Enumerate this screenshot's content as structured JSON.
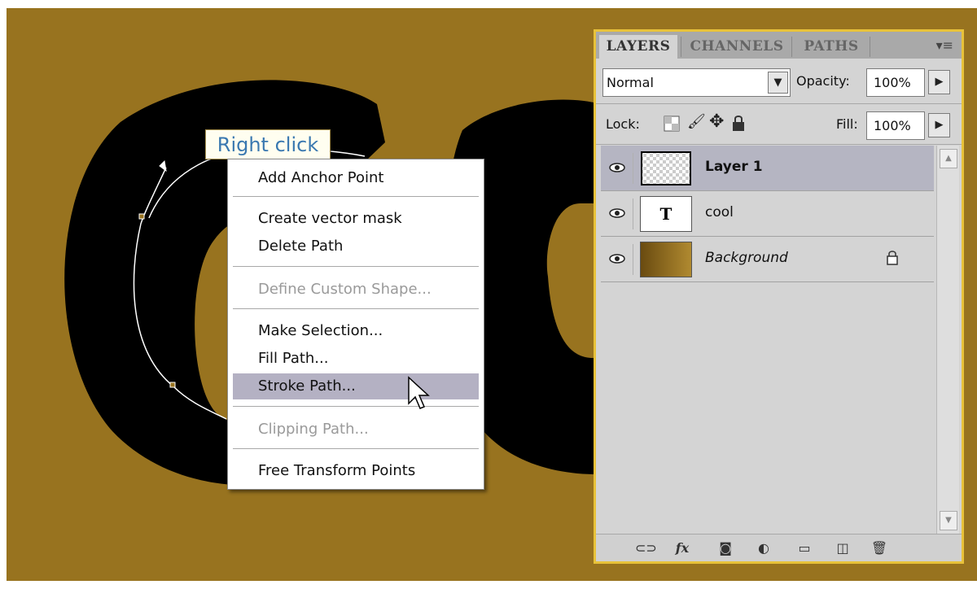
{
  "tooltip": "Right click",
  "context_menu": {
    "items": [
      {
        "label": "Add Anchor Point",
        "enabled": true
      },
      {
        "label": "Create vector mask",
        "enabled": true
      },
      {
        "label": "Delete Path",
        "enabled": true
      },
      {
        "label": "Define Custom Shape...",
        "enabled": false
      },
      {
        "label": "Make Selection...",
        "enabled": true
      },
      {
        "label": "Fill Path...",
        "enabled": true
      },
      {
        "label": "Stroke Path...",
        "enabled": true,
        "highlighted": true
      },
      {
        "label": "Clipping Path...",
        "enabled": false
      },
      {
        "label": "Free Transform Points",
        "enabled": true
      }
    ]
  },
  "layers_panel": {
    "tabs": [
      "LAYERS",
      "CHANNELS",
      "PATHS"
    ],
    "active_tab": "LAYERS",
    "blend_mode": "Normal",
    "opacity_label": "Opacity:",
    "opacity": "100%",
    "lock_label": "Lock:",
    "fill_label": "Fill:",
    "fill": "100%",
    "layers": [
      {
        "name": "Layer 1",
        "type": "transparent",
        "selected": true,
        "visible": true
      },
      {
        "name": "cool",
        "type": "text",
        "thumb_glyph": "T",
        "selected": false,
        "visible": true
      },
      {
        "name": "Background",
        "type": "gradient",
        "selected": false,
        "visible": true,
        "locked": true
      }
    ]
  },
  "colors": {
    "canvas": "#98731f",
    "text_fill": "#000000",
    "panel_border": "#e8c23a",
    "menu_highlight": "#b4b1c3",
    "tooltip_text": "#3a78b0"
  },
  "icons": [
    "eye-icon",
    "lock-icon",
    "brush-icon",
    "move-icon",
    "link-icon",
    "fx-icon",
    "mask-icon",
    "adjustment-icon",
    "folder-icon",
    "new-layer-icon",
    "trash-icon",
    "chevron-down-icon",
    "arrow-right-icon",
    "panel-menu-icon",
    "cursor-icon"
  ]
}
